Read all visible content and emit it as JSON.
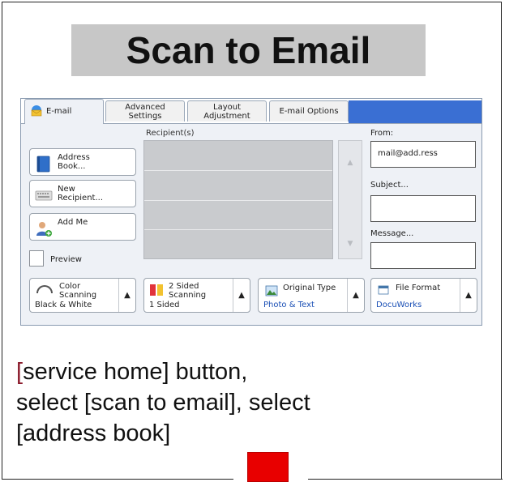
{
  "title": "Scan to Email",
  "tabs": [
    {
      "label": "E-mail",
      "icon": "email-envelope-icon",
      "active": true
    },
    {
      "label": "Advanced\nSettings",
      "active": false
    },
    {
      "label": "Layout\nAdjustment",
      "active": false
    },
    {
      "label": "E-mail Options",
      "active": false
    }
  ],
  "left_buttons": {
    "address_book": "Address\nBook...",
    "new_recipient": "New\nRecipient...",
    "add_me": "Add Me"
  },
  "recipients_header": "Recipient(s)",
  "from_label": "From:",
  "from_value": "mail@add.ress",
  "subject_label": "Subject...",
  "message_label": "Message...",
  "preview_label": "Preview",
  "bottom_buttons": {
    "color": {
      "label": "Color\n  Scanning",
      "value": "Black & White"
    },
    "sided": {
      "label": "2 Sided\nScanning",
      "value": "1 Sided"
    },
    "original_type": {
      "label": "Original Type",
      "value": "Photo & Text"
    },
    "file_format": {
      "label": "File Format",
      "value": "DocuWorks"
    }
  },
  "instruction": {
    "open_bracket": "[",
    "line1_rest": "service home] button,",
    "line2": "select [scan to email], select",
    "line3": "[address book]"
  },
  "colors": {
    "tab_strip_blue": "#3a6fd3",
    "value_blue": "#1a4fb5",
    "title_box_gray": "#c7c7c7",
    "marker_red": "#e80000"
  }
}
